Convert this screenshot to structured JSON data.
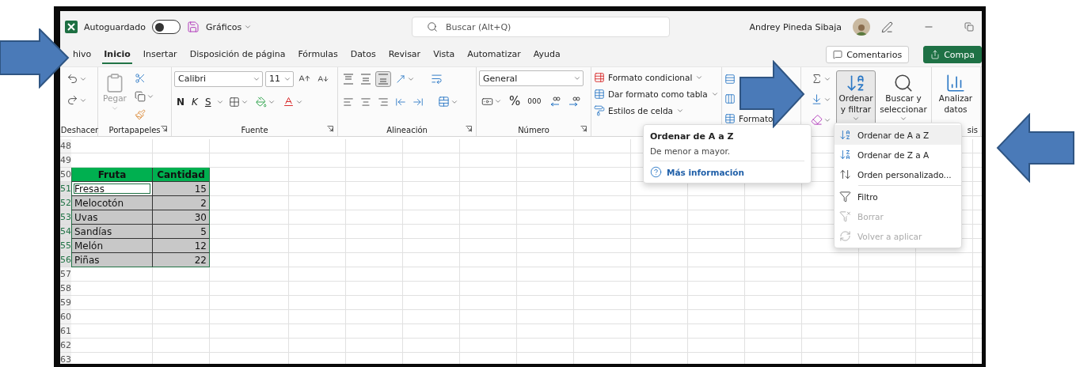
{
  "title_bar": {
    "autosave_label": "Autoguardado",
    "autosave_on": false,
    "file_name": "Gráficos",
    "search": {
      "placeholder": "Buscar (Alt+Q)"
    },
    "user_name": "Andrey Pineda Sibaja"
  },
  "tabs": [
    {
      "label": "hivo",
      "selected": false
    },
    {
      "label": "Inicio",
      "selected": true
    },
    {
      "label": "Insertar",
      "selected": false
    },
    {
      "label": "Disposición de página",
      "selected": false
    },
    {
      "label": "Fórmulas",
      "selected": false
    },
    {
      "label": "Datos",
      "selected": false
    },
    {
      "label": "Revisar",
      "selected": false
    },
    {
      "label": "Vista",
      "selected": false
    },
    {
      "label": "Automatizar",
      "selected": false
    },
    {
      "label": "Ayuda",
      "selected": false
    }
  ],
  "actions": [
    {
      "label": "Comentarios",
      "kind": "outline"
    },
    {
      "label": "Compa",
      "kind": "primary"
    }
  ],
  "ribbon": {
    "undo": {
      "label": "Deshacer"
    },
    "clipboard": {
      "label": "Portapapeles",
      "paste": {
        "label": "Pegar",
        "disabled": true
      }
    },
    "font": {
      "label": "Fuente",
      "font_name": "Calibri",
      "font_size": "11",
      "bold": "N",
      "italic": "K",
      "underline": "S"
    },
    "alignment": {
      "label": "Alineación",
      "vertical": [
        {
          "selected": false
        },
        {
          "selected": false
        },
        {
          "selected": true
        }
      ]
    },
    "number": {
      "label": "Número",
      "format": "General",
      "percent": "%",
      "thousands": "000"
    },
    "styles": {
      "items": [
        {
          "label": "Formato condicional"
        },
        {
          "label": "Dar formato como tabla"
        },
        {
          "label": "Estilos de celda"
        }
      ]
    },
    "cells": {
      "items": [
        {
          "kind": "insert"
        },
        {
          "kind": "delete"
        },
        {
          "kind": "format",
          "label": "Formato"
        }
      ]
    },
    "editing": {
      "sort_filter": {
        "label": "Ordenar y filtrar",
        "pressed": true
      },
      "find": {
        "label": "Buscar y seleccionar"
      }
    },
    "analysis": {
      "button": "Analizar datos",
      "label": "sis"
    }
  },
  "sheet": {
    "rows": [
      {
        "number": "48",
        "selected": false
      },
      {
        "number": "49",
        "selected": false
      },
      {
        "number": "50",
        "selected": false,
        "cells": [
          {
            "text": "Fruta",
            "kind": "header",
            "active": false
          },
          {
            "text": "Cantidad",
            "kind": "header",
            "active": false
          }
        ]
      },
      {
        "number": "51",
        "selected": true,
        "cells": [
          {
            "text": "Fresas",
            "kind": "text",
            "active": true
          },
          {
            "text": "15",
            "kind": "number",
            "active": false
          }
        ]
      },
      {
        "number": "52",
        "selected": true,
        "cells": [
          {
            "text": "Melocotón",
            "kind": "text",
            "active": false
          },
          {
            "text": "2",
            "kind": "number",
            "active": false
          }
        ]
      },
      {
        "number": "53",
        "selected": true,
        "cells": [
          {
            "text": "Uvas",
            "kind": "text",
            "active": false
          },
          {
            "text": "30",
            "kind": "number",
            "active": false
          }
        ]
      },
      {
        "number": "54",
        "selected": true,
        "cells": [
          {
            "text": "Sandías",
            "kind": "text",
            "active": false
          },
          {
            "text": "5",
            "kind": "number",
            "active": false
          }
        ]
      },
      {
        "number": "55",
        "selected": true,
        "cells": [
          {
            "text": "Melón",
            "kind": "text",
            "active": false
          },
          {
            "text": "12",
            "kind": "number",
            "active": false
          }
        ]
      },
      {
        "number": "56",
        "selected": true,
        "cells": [
          {
            "text": "Piñas",
            "kind": "text",
            "active": false
          },
          {
            "text": "22",
            "kind": "number",
            "active": false
          }
        ]
      },
      {
        "number": "57",
        "selected": false
      },
      {
        "number": "58",
        "selected": false
      },
      {
        "number": "59",
        "selected": false
      },
      {
        "number": "60",
        "selected": false
      },
      {
        "number": "61",
        "selected": false
      },
      {
        "number": "62",
        "selected": false
      },
      {
        "number": "63",
        "selected": false
      }
    ]
  },
  "tooltip": {
    "title": "Ordenar de A a Z",
    "description": "De menor a mayor.",
    "link": "Más información"
  },
  "menu": [
    {
      "kind": "sort-az",
      "label": "Ordenar de A a Z",
      "selected": true,
      "disabled": false
    },
    {
      "kind": "sort-za",
      "label": "Ordenar de Z a A",
      "selected": false,
      "disabled": false
    },
    {
      "kind": "custom-sort",
      "label": "Orden personalizado...",
      "selected": false,
      "disabled": false
    },
    {
      "kind": "divider"
    },
    {
      "kind": "filter",
      "label": "Filtro",
      "selected": false,
      "disabled": false
    },
    {
      "kind": "clear-filter",
      "label": "Borrar",
      "selected": false,
      "disabled": true
    },
    {
      "kind": "reapply",
      "label": "Volver a aplicar",
      "selected": false,
      "disabled": true
    }
  ]
}
